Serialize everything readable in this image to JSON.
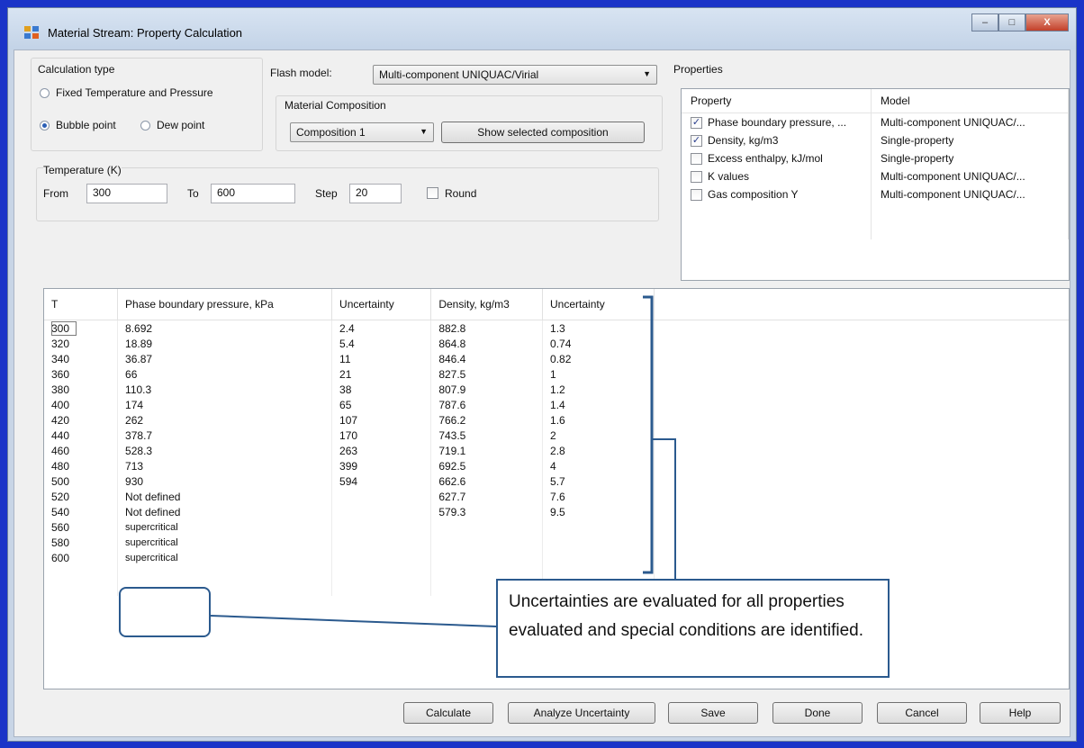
{
  "window": {
    "title": "Material Stream: Property Calculation",
    "controls": {
      "minimize": "–",
      "maximize": "□",
      "close": "X"
    }
  },
  "calc_type": {
    "label": "Calculation type",
    "fixed": "Fixed Temperature and Pressure",
    "bubble": "Bubble point",
    "dew": "Dew point",
    "selected": "Bubble point"
  },
  "flash": {
    "label": "Flash model:",
    "value": "Multi-component UNIQUAC/Virial"
  },
  "composition": {
    "label": "Material Composition",
    "value": "Composition 1",
    "show_button": "Show selected composition"
  },
  "temperature": {
    "label": "Temperature (K)",
    "from_label": "From",
    "from": "300",
    "to_label": "To",
    "to": "600",
    "step_label": "Step",
    "step": "20",
    "round_label": "Round"
  },
  "properties": {
    "label": "Properties",
    "headers": [
      "Property",
      "Model"
    ],
    "rows": [
      {
        "name": "Phase boundary pressure, ...",
        "model": "Multi-component UNIQUAC/...",
        "checked": true
      },
      {
        "name": "Density, kg/m3",
        "model": "Single-property",
        "checked": true
      },
      {
        "name": "Excess enthalpy, kJ/mol",
        "model": "Single-property",
        "checked": false
      },
      {
        "name": "K values",
        "model": "Multi-component UNIQUAC/...",
        "checked": false
      },
      {
        "name": "Gas composition Y",
        "model": "Multi-component UNIQUAC/...",
        "checked": false
      }
    ]
  },
  "results": {
    "headers": [
      "T",
      "Phase boundary pressure, kPa",
      "Uncertainty",
      "Density, kg/m3",
      "Uncertainty"
    ],
    "rows": [
      [
        "300",
        "8.692",
        "2.4",
        "882.8",
        "1.3"
      ],
      [
        "320",
        "18.89",
        "5.4",
        "864.8",
        "0.74"
      ],
      [
        "340",
        "36.87",
        "11",
        "846.4",
        "0.82"
      ],
      [
        "360",
        "66",
        "21",
        "827.5",
        "1"
      ],
      [
        "380",
        "110.3",
        "38",
        "807.9",
        "1.2"
      ],
      [
        "400",
        "174",
        "65",
        "787.6",
        "1.4"
      ],
      [
        "420",
        "262",
        "107",
        "766.2",
        "1.6"
      ],
      [
        "440",
        "378.7",
        "170",
        "743.5",
        "2"
      ],
      [
        "460",
        "528.3",
        "263",
        "719.1",
        "2.8"
      ],
      [
        "480",
        "713",
        "399",
        "692.5",
        "4"
      ],
      [
        "500",
        "930",
        "594",
        "662.6",
        "5.7"
      ],
      [
        "520",
        "Not defined",
        "",
        "627.7",
        "7.6"
      ],
      [
        "540",
        "Not defined",
        "",
        "579.3",
        "9.5"
      ],
      [
        "560",
        "supercritical",
        "",
        "",
        ""
      ],
      [
        "580",
        "supercritical",
        "",
        "",
        ""
      ],
      [
        "600",
        "supercritical",
        "",
        "",
        ""
      ]
    ]
  },
  "callout": "Uncertainties are evaluated for all properties evaluated and special conditions are identified.",
  "buttons": {
    "calculate": "Calculate",
    "analyze": "Analyze Uncertainty",
    "save": "Save",
    "done": "Done",
    "cancel": "Cancel",
    "help": "Help"
  },
  "colors": {
    "desktop": "#1a34c8",
    "annotation": "#2b5a8e"
  }
}
